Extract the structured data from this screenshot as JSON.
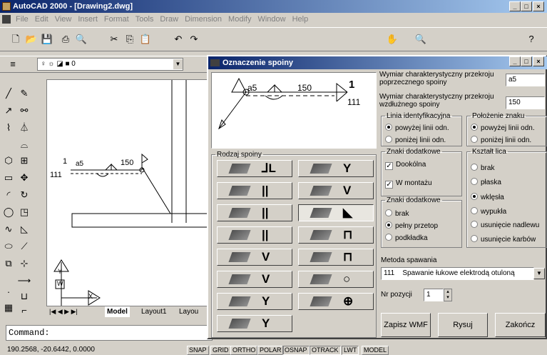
{
  "app": {
    "title": "AutoCAD 2000 - [Drawing2.dwg]"
  },
  "menu": [
    "File",
    "Edit",
    "View",
    "Insert",
    "Format",
    "Tools",
    "Draw",
    "Dimension",
    "Modify",
    "Window",
    "Help"
  ],
  "layer": {
    "value": "0"
  },
  "tabs": {
    "model": "Model",
    "layout1": "Layout1",
    "layout2": "Layou"
  },
  "command": {
    "prompt": "Command:"
  },
  "status": {
    "coords": "190.2568, -20.6442, 0.0000",
    "buttons": [
      "SNAP",
      "GRID",
      "ORTHO",
      "POLAR",
      "OSNAP",
      "OTRACK",
      "LWT",
      "MODEL"
    ]
  },
  "drawing": {
    "left_label": "1",
    "size": "a5",
    "length": "150",
    "num": "111",
    "ucs_y": "Y",
    "ucs_w": "W",
    "ucs_x": "X"
  },
  "dialog": {
    "title": "Oznaczenie spoiny",
    "preview": {
      "a": "a5",
      "len": "150",
      "ref": "1",
      "num": "111"
    },
    "rodzaj_legend": "Rodzaj spoiny",
    "wymiar_poprzeczny_label": "Wymiar charakterystyczny przekroju poprzecznego spoiny",
    "wymiar_poprzeczny_value": "a5",
    "wymiar_wzdluzny_label": "Wymiar charakterystyczny przekroju wzdłużnego spoiny",
    "wymiar_wzdluzny_value": "150",
    "linia": {
      "legend": "Linia identyfikacyjna",
      "opt1": "powyżej linii odn.",
      "opt2": "poniżej linii odn."
    },
    "polozenie": {
      "legend": "Położenie znaku",
      "opt1": "powyżej linii odn.",
      "opt2": "poniżej linii odn."
    },
    "znaki1": {
      "legend": "Znaki dodatkowe",
      "opt1": "Dookólna",
      "opt2": "W montażu"
    },
    "znaki2": {
      "legend": "Znaki dodatkowe",
      "opt1": "brak",
      "opt2": "pełny przetop",
      "opt3": "podkładka"
    },
    "ksztalt": {
      "legend": "Kształt lica",
      "opts": [
        "brak",
        "płaska",
        "wklęsła",
        "wypukła",
        "usunięcie nadlewu",
        "usunięcie karbów"
      ]
    },
    "metoda_label": "Metoda spawania",
    "metoda_value": "111    Spawanie łukowe elektrodą otuloną",
    "nr_label": "Nr pozycji",
    "nr_value": "1",
    "btn_wmf": "Zapisz WMF",
    "btn_rysuj": "Rysuj",
    "btn_zakoncz": "Zakończ",
    "symbols": [
      "⅃L",
      "Y",
      "||",
      "V",
      "||",
      "◣",
      "||",
      "⊓",
      "V",
      "⊓",
      "V",
      "○",
      "Y",
      "⊕",
      "Y"
    ]
  }
}
